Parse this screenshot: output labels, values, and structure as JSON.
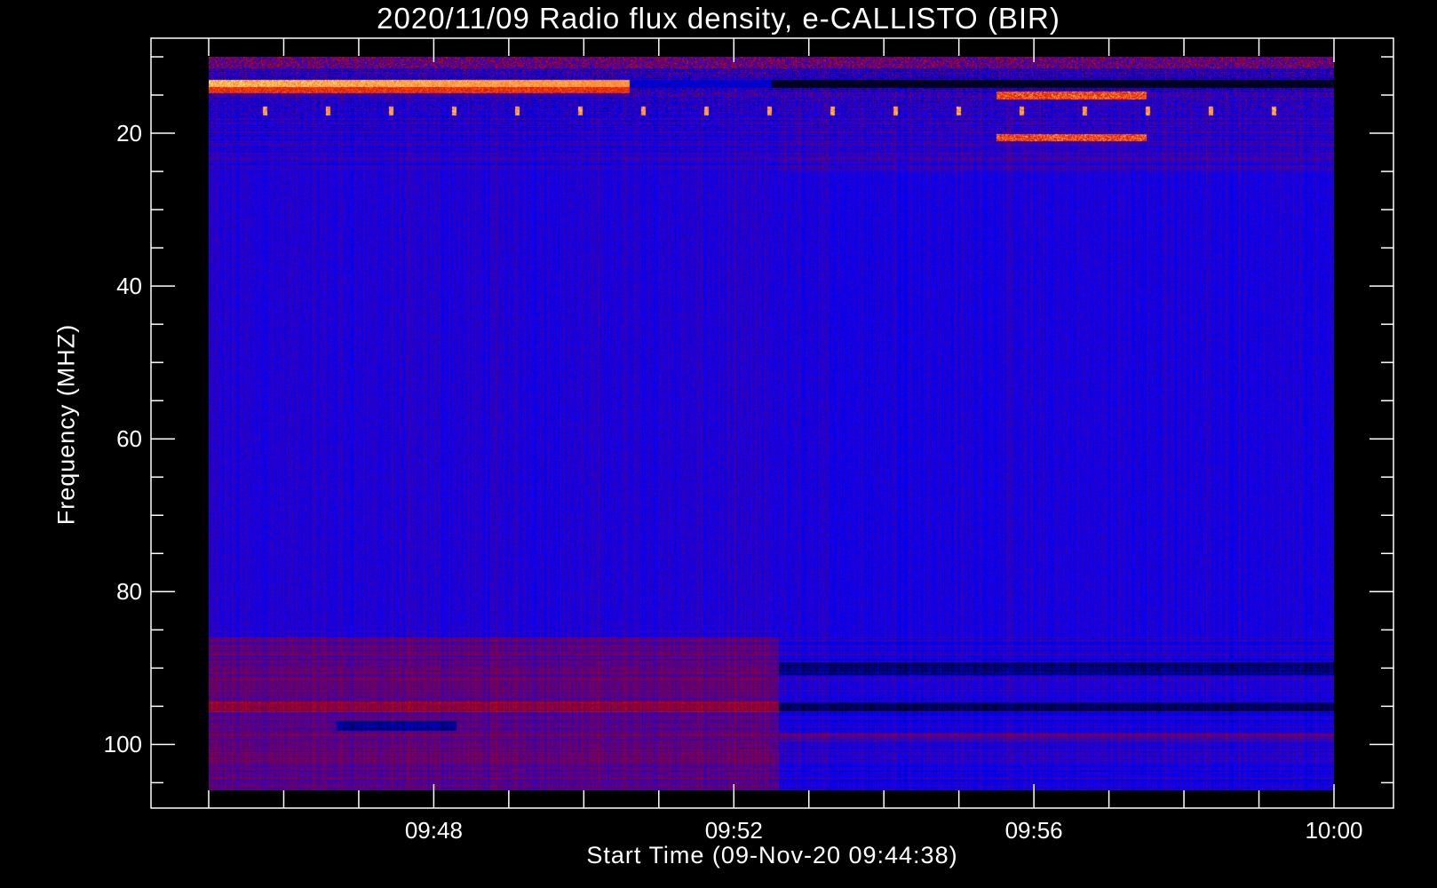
{
  "chart_data": {
    "type": "heatmap",
    "title": "2020/11/09  Radio flux density, e-CALLISTO (BIR)",
    "xlabel": "Start Time (09-Nov-20 09:44:38)",
    "ylabel": "Frequency (MHZ)",
    "x_unit": "minutes after 09:45",
    "xlim": [
      -0.77,
      15.2
    ],
    "data_x_range": [
      0,
      15
    ],
    "x_ticks": [
      {
        "value": 3,
        "label": "09:48"
      },
      {
        "value": 7,
        "label": "09:52"
      },
      {
        "value": 11,
        "label": "09:56"
      },
      {
        "value": 15,
        "label": "10:00"
      }
    ],
    "x_minor_step": 1,
    "ylim": [
      107.5,
      7.5
    ],
    "data_y_range": [
      10,
      106
    ],
    "y_ticks": [
      {
        "value": 20,
        "label": "20"
      },
      {
        "value": 40,
        "label": "40"
      },
      {
        "value": 60,
        "label": "60"
      },
      {
        "value": 80,
        "label": "80"
      },
      {
        "value": 100,
        "label": "100"
      }
    ],
    "y_minor_step": 5,
    "colormap": [
      "#000000",
      "#0000ff",
      "#b00000",
      "#ff4000",
      "#ffff80"
    ],
    "features": [
      {
        "name": "bright band",
        "freq_mhz": 13.5,
        "t_start": 0,
        "t_end": 5.6
      },
      {
        "name": "periodic spikes",
        "freq_mhz": 17,
        "period_min": 0.85
      },
      {
        "name": "burst cluster",
        "freq_mhz": [
          15,
          21
        ],
        "t_start": 10.5,
        "t_end": 12.5
      },
      {
        "name": "background change",
        "t": 7.6
      }
    ]
  }
}
